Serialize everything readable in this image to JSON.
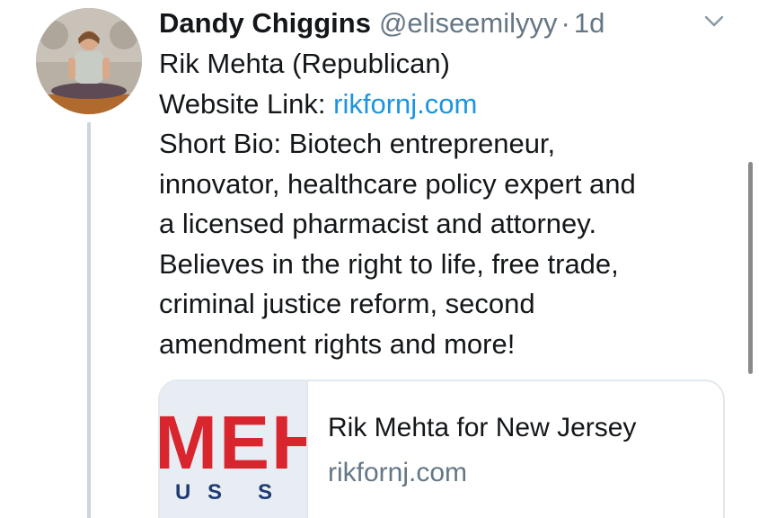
{
  "tweet": {
    "display_name": "Dandy Chiggins",
    "handle": "@eliseemilyyy",
    "separator": "·",
    "time": "1d",
    "avatar_icon": "profile-photo",
    "menu_icon": "chevron-down-icon",
    "lines": {
      "line1": "Rik Mehta (Republican)",
      "website_label": "Website Link: ",
      "website_link": "rikfornj.com",
      "line3": "Short Bio: Biotech entrepreneur,",
      "line4": "innovator, healthcare policy expert and",
      "line5": "a licensed pharmacist and attorney.",
      "line6": "Believes in the right to life, free trade,",
      "line7": "criminal justice reform, second",
      "line8": "amendment rights and more!"
    },
    "card": {
      "thumb_big": "MEH",
      "thumb_small_1": "U",
      "thumb_small_2": "S",
      "thumb_small_3": "S",
      "title": "Rik Mehta for New Jersey",
      "domain": "rikfornj.com"
    }
  },
  "colors": {
    "link": "#1b95e0",
    "muted": "#657786",
    "text": "#14171a",
    "thumb_red": "#d9252e",
    "thumb_blue": "#1f3b73"
  }
}
